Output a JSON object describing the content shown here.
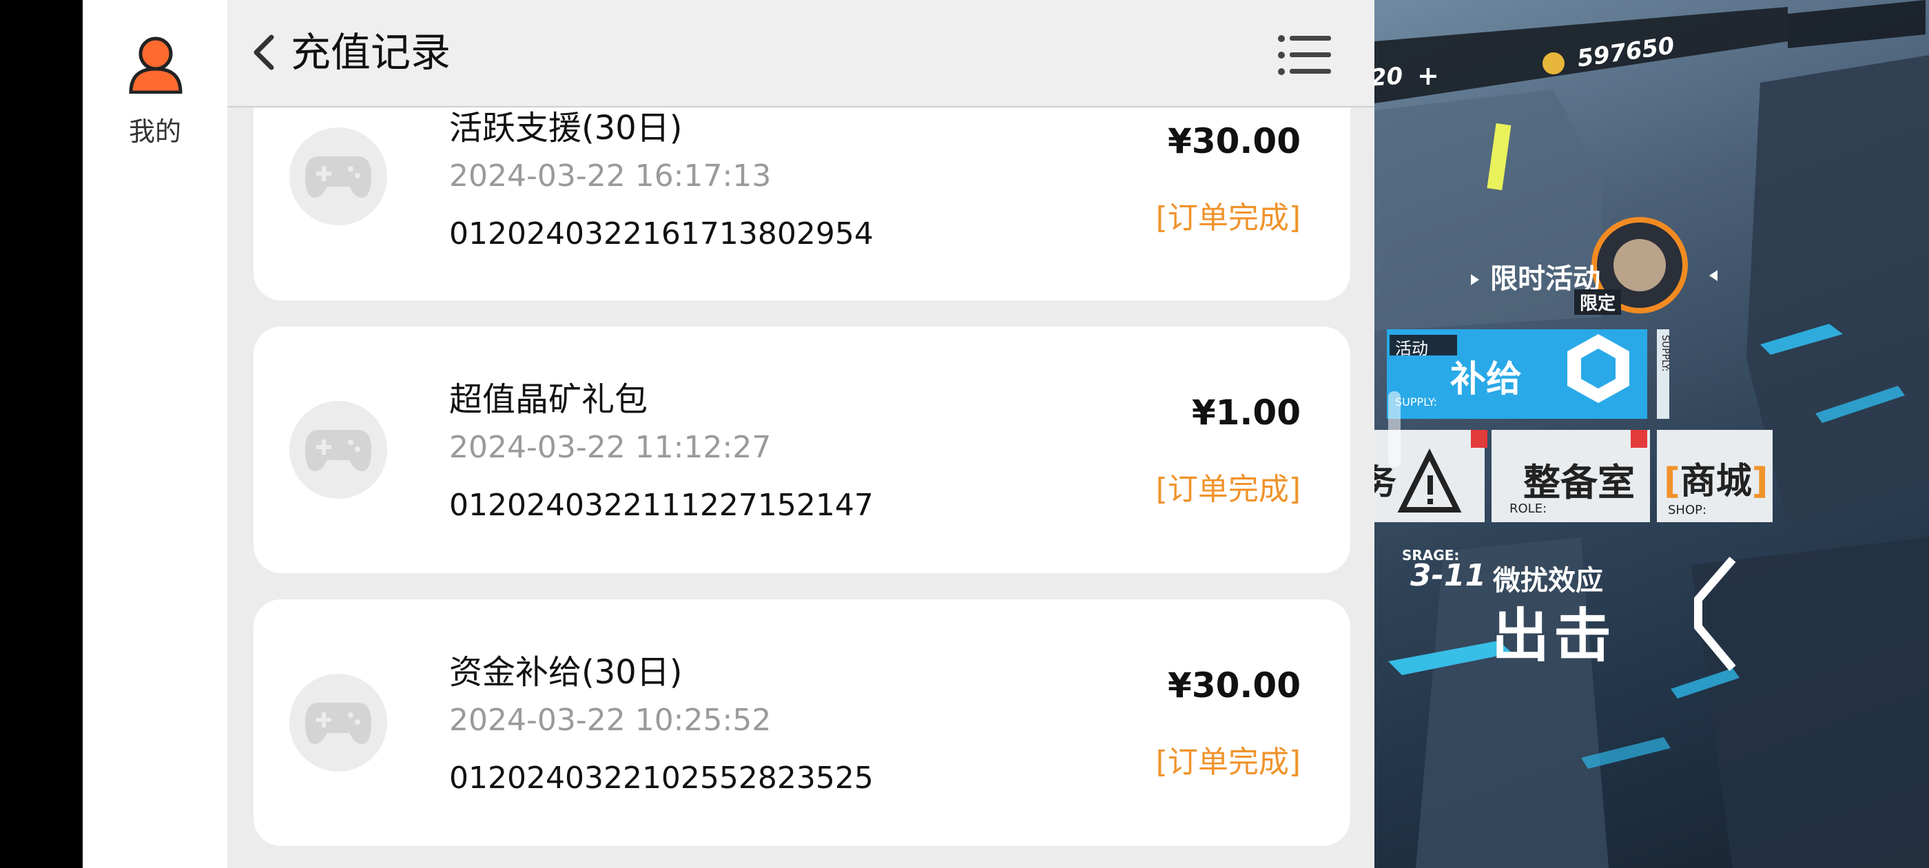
{
  "sidebar": {
    "mine_label": "我的"
  },
  "header": {
    "title": "充值记录"
  },
  "records": [
    {
      "name": "活跃支援(30日)",
      "date": "2024-03-22 16:17:13",
      "order_id": "0120240322161713802954",
      "price": "¥30.00",
      "status": "[订单完成]"
    },
    {
      "name": "超值晶矿礼包",
      "date": "2024-03-22 11:12:27",
      "order_id": "0120240322111227152147",
      "price": "¥1.00",
      "status": "[订单完成]"
    },
    {
      "name": "资金补给(30日)",
      "date": "2024-03-22 10:25:52",
      "order_id": "0120240322102552823525",
      "price": "¥30.00",
      "status": "[订单完成]"
    }
  ],
  "game": {
    "currency_partial": "20",
    "plus": "+",
    "coins": "597650",
    "event_label": "限时活动",
    "limited_badge": "限定",
    "activity_tag": "活动",
    "supply_label": "补给",
    "supply_en": "SUPPLY:",
    "supply_side": "SUPPLY:",
    "task_partial": "务",
    "armory_label": "整备室",
    "armory_en": "ROLE:",
    "shop_label": "商城",
    "shop_en": "SHOP:",
    "stage_en": "SRAGE:",
    "stage_num": "3-11",
    "stage_name": "微扰效应",
    "sortie": "出击"
  },
  "colors": {
    "accent_orange": "#f0932b",
    "supply_blue": "#29a9e8",
    "avatar_orange": "#ff6a2f"
  }
}
